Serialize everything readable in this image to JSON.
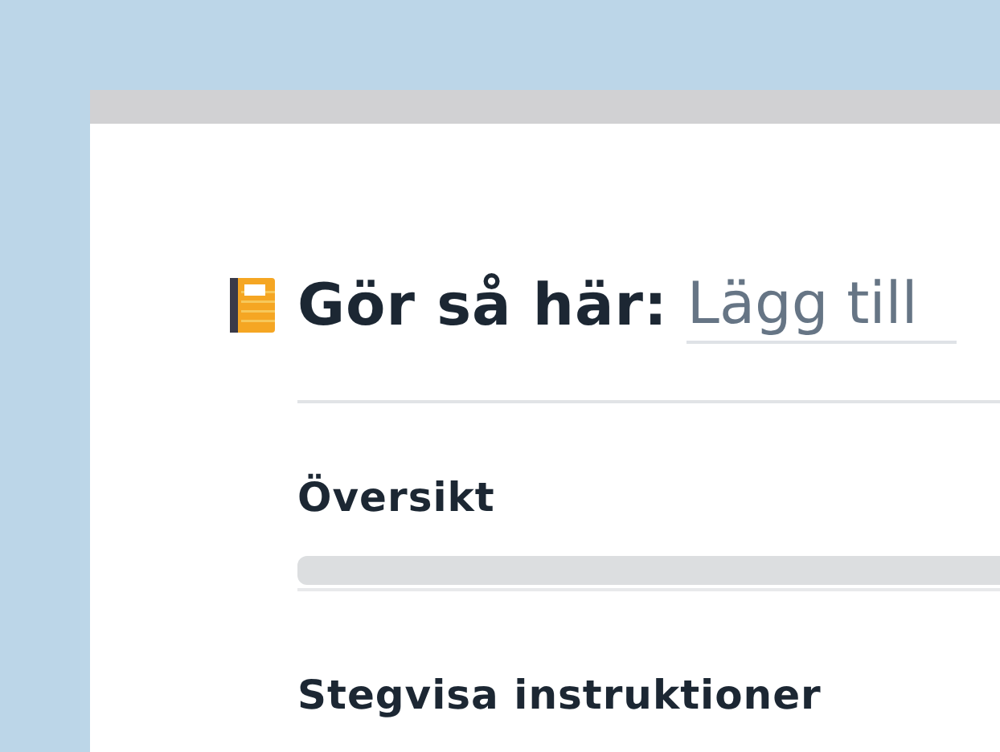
{
  "heading": {
    "title": "Gör så här:",
    "name_field": {
      "placeholder": "Lägg till"
    }
  },
  "sections": [
    {
      "title": "Översikt",
      "kind": "field"
    },
    {
      "title": "Stegvisa instruktioner",
      "kind": "plain"
    }
  ]
}
